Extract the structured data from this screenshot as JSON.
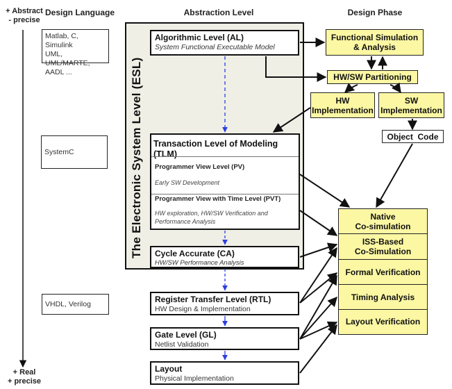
{
  "axis": {
    "top_line1": "+ Abstract",
    "top_line2": "- precise",
    "bottom_line1": "+ Real",
    "bottom_line2": "+ precise"
  },
  "headers": {
    "design_language": "Design Language",
    "abstraction_level": "Abstraction Level",
    "design_phase": "Design Phase"
  },
  "design_languages": [
    {
      "lines": [
        "Matlab, C, Simulink",
        "UML, UML/MARTE,",
        "AADL ..."
      ]
    },
    {
      "lines": [
        "SystemC"
      ]
    },
    {
      "lines": [
        "VHDL, Verilog"
      ]
    }
  ],
  "esl": {
    "title": "The Electronic System Level (ESL)"
  },
  "levels": {
    "al": {
      "title": "Algorithmic Level (AL)",
      "subtitle": "System Functional Executable Model"
    },
    "tlm": {
      "title": "Transaction Level of Modeling (TLM)",
      "pv": {
        "title": "Programmer View Level (PV)",
        "desc": "Early SW Development"
      },
      "pvt": {
        "title": "Programmer View with Time Level (PVT)",
        "desc_line1": "HW exploration, HW/SW Verification and",
        "desc_line2": "Performance Analysis"
      }
    },
    "ca": {
      "title": "Cycle Accurate (CA)",
      "subtitle": "HW/SW Performance Analysis"
    },
    "rtl": {
      "title": "Register Transfer Level (RTL)",
      "subtitle": "HW Design & Implementation"
    },
    "gl": {
      "title": "Gate Level (GL)",
      "subtitle": "Netlist Validation"
    },
    "layout": {
      "title": "Layout",
      "subtitle": "Physical Implementation"
    }
  },
  "phases": {
    "func_sim": {
      "line1": "Functional Simulation",
      "line2": "& Analysis"
    },
    "partitioning": "HW/SW Partitioning",
    "hw_impl": {
      "line1": "HW",
      "line2": "Implementation"
    },
    "sw_impl": {
      "line1": "SW",
      "line2": "Implementation"
    },
    "object_code": "Object  Code",
    "native_cosim": {
      "line1": "Native",
      "line2": "Co-simulation"
    },
    "iss_cosim": {
      "line1": "ISS-Based",
      "line2": "Co-Simulation"
    },
    "formal_verif": "Formal Verification",
    "timing": "Timing Analysis",
    "layout_verif": "Layout Verification"
  },
  "colors": {
    "phase_fill": "#fbf7a3",
    "esl_fill": "#efefe6",
    "refinement_arrow": "#2b3fe0",
    "line": "#111111"
  }
}
